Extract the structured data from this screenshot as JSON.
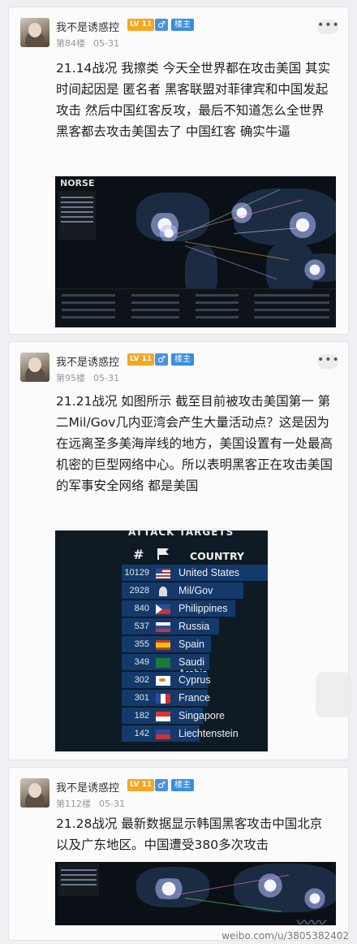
{
  "posts": [
    {
      "username": "我不是诱惑控",
      "level": "LV 11",
      "gender_icon": "♂",
      "role": "楼主",
      "floor": "第84楼",
      "date": "05-31",
      "more": "•••",
      "text": "21.14战况 我擦类 今天全世界都在攻击美国 其实时间起因是 匿名者 黑客联盟对菲律宾和中国发起攻击 然后中国红客反攻，最后不知道怎么全世界黑客都去攻击美国去了 中国红客 确实牛逼",
      "image_header": "NORSE"
    },
    {
      "username": "我不是诱惑控",
      "level": "LV 11",
      "gender_icon": "♂",
      "role": "楼主",
      "floor": "第95楼",
      "date": "05-31",
      "more": "•••",
      "text": "21.21战况 如图所示 截至目前被攻击美国第一 第二Mil/Gov几内亚湾会产生大量活动点？这是因为在远离圣多美海岸线的地方，美国设置有一处最高机密的巨型网络中心。所以表明黑客正在攻击美国的军事安全网络 都是美国",
      "targets": {
        "title": "ATTACK TARGETS",
        "col_hash": "#",
        "col_country": "COUNTRY",
        "rows": [
          {
            "count": "10129",
            "country": "United States",
            "flag": "us"
          },
          {
            "count": "2928",
            "country": "Mil/Gov",
            "flag": "mil"
          },
          {
            "count": "840",
            "country": "Philippines",
            "flag": "ph"
          },
          {
            "count": "537",
            "country": "Russia",
            "flag": "ru"
          },
          {
            "count": "355",
            "country": "Spain",
            "flag": "es"
          },
          {
            "count": "349",
            "country": "Saudi Arabia",
            "flag": "sa"
          },
          {
            "count": "302",
            "country": "Cyprus",
            "flag": "cy"
          },
          {
            "count": "301",
            "country": "France",
            "flag": "fr"
          },
          {
            "count": "182",
            "country": "Singapore",
            "flag": "sg"
          },
          {
            "count": "142",
            "country": "Liechtenstein",
            "flag": "li"
          }
        ]
      }
    },
    {
      "username": "我不是诱惑控",
      "level": "LV 11",
      "gender_icon": "♂",
      "role": "楼主",
      "floor": "第112楼",
      "date": "05-31",
      "more": "•••",
      "text": "21.28战况 最新数据显示韩国黑客攻击中国北京以及广东地区。中国遭受380多次攻击"
    }
  ],
  "watermark": "weibo.com/u/3805382402"
}
